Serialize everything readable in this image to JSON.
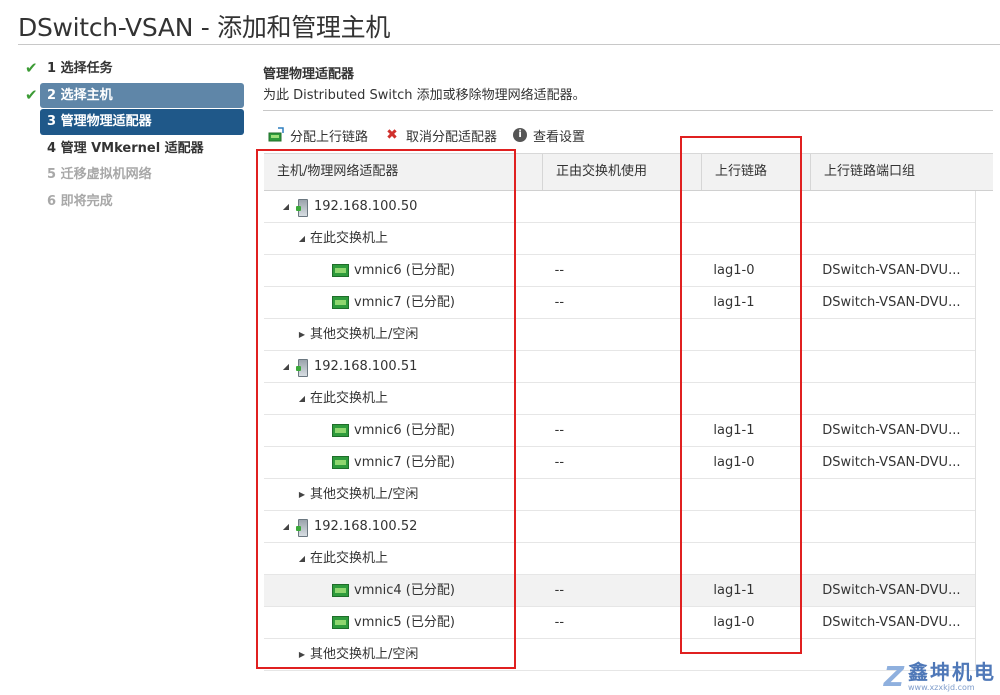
{
  "window": {
    "title": "DSwitch-VSAN - 添加和管理主机"
  },
  "steps": [
    {
      "label": "1 选择任务",
      "state": "done"
    },
    {
      "label": "2 选择主机",
      "state": "done-active"
    },
    {
      "label": "3 管理物理适配器",
      "state": "current"
    },
    {
      "label": "4 管理 VMkernel 适配器",
      "state": "plain"
    },
    {
      "label": "5 迁移虚拟机网络",
      "state": "pending"
    },
    {
      "label": "6 即将完成",
      "state": "pending"
    }
  ],
  "section": {
    "title": "管理物理适配器",
    "description": "为此 Distributed Switch 添加或移除物理网络适配器。"
  },
  "toolbar": {
    "assign_uplink": "分配上行链路",
    "unassign_adapter": "取消分配适配器",
    "view_settings": "查看设置"
  },
  "grid": {
    "headers": [
      "主机/物理网络适配器",
      "正由交换机使用",
      "上行链路",
      "上行链路端口组"
    ],
    "rows": [
      {
        "type": "host",
        "name": "192.168.100.50"
      },
      {
        "type": "group",
        "name": "在此交换机上",
        "expanded": true
      },
      {
        "type": "nic",
        "name": "vmnic6 (已分配)",
        "in_use": "--",
        "uplink": "lag1-0",
        "portgroup": "DSwitch-VSAN-DVU..."
      },
      {
        "type": "nic",
        "name": "vmnic7 (已分配)",
        "in_use": "--",
        "uplink": "lag1-1",
        "portgroup": "DSwitch-VSAN-DVU..."
      },
      {
        "type": "group",
        "name": "其他交换机上/空闲",
        "expanded": false
      },
      {
        "type": "host",
        "name": "192.168.100.51"
      },
      {
        "type": "group",
        "name": "在此交换机上",
        "expanded": true
      },
      {
        "type": "nic",
        "name": "vmnic6 (已分配)",
        "in_use": "--",
        "uplink": "lag1-1",
        "portgroup": "DSwitch-VSAN-DVU..."
      },
      {
        "type": "nic",
        "name": "vmnic7 (已分配)",
        "in_use": "--",
        "uplink": "lag1-0",
        "portgroup": "DSwitch-VSAN-DVU..."
      },
      {
        "type": "group",
        "name": "其他交换机上/空闲",
        "expanded": false
      },
      {
        "type": "host",
        "name": "192.168.100.52"
      },
      {
        "type": "group",
        "name": "在此交换机上",
        "expanded": true
      },
      {
        "type": "nic",
        "name": "vmnic4 (已分配)",
        "in_use": "--",
        "uplink": "lag1-1",
        "portgroup": "DSwitch-VSAN-DVU...",
        "selected": true
      },
      {
        "type": "nic",
        "name": "vmnic5 (已分配)",
        "in_use": "--",
        "uplink": "lag1-0",
        "portgroup": "DSwitch-VSAN-DVU..."
      },
      {
        "type": "group",
        "name": "其他交换机上/空闲",
        "expanded": false
      }
    ]
  },
  "watermark": {
    "name": "鑫坤机电",
    "url": "www.xzxkjd.com"
  },
  "colors": {
    "accent": "#1f5889",
    "done_check": "#3c9b35",
    "highlight": "#e02020"
  }
}
